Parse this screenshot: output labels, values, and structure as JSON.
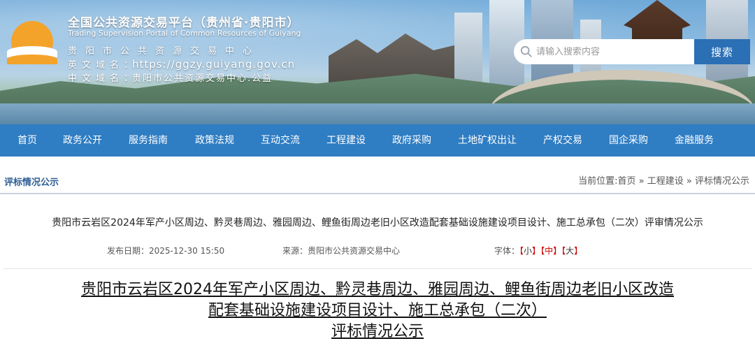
{
  "header": {
    "title": "全国公共资源交易平台（贵州省·贵阳市）",
    "title_en": "Trading Supervision Portal of Common Resources of Guiyang",
    "center_name": "贵阳市公共资源交易中心",
    "en_domain_label": "英文域名：",
    "en_domain_value": "https://ggzy.guiyang.gov.cn",
    "cn_domain_label": "中文域名：",
    "cn_domain_value": "贵阳市公共资源交易中心.公益",
    "brand_color": "#2f7dc3",
    "logo_color": "#f4a32a"
  },
  "search": {
    "placeholder": "请输入搜索内容",
    "button_label": "搜索",
    "icon": "search-icon"
  },
  "nav": {
    "items": [
      "首页",
      "政务公开",
      "服务指南",
      "政策法规",
      "互动交流",
      "工程建设",
      "政府采购",
      "土地矿权出让",
      "产权交易",
      "国企采购",
      "金融服务"
    ]
  },
  "breadcrumb": {
    "section_title": "评标情况公示",
    "path_label": "当前位置:",
    "path": [
      "首页",
      "工程建设",
      "评标情况公示"
    ],
    "separator": " » "
  },
  "article": {
    "title": "贵阳市云岩区2024年军产小区周边、黔灵巷周边、雅园周边、鲤鱼街周边老旧小区改造配套基础设施建设项目设计、施工总承包（二次）评审情况公示",
    "date_label": "发布日期：",
    "date_value": "2025-12-30 15:50",
    "source_label": "来源：",
    "source_value": "贵阳市公共资源交易中心",
    "font_label": "字体：",
    "font_small": "小",
    "font_medium": "中",
    "font_large": "大",
    "heading_lines": [
      "贵阳市云岩区2024年军产小区周边、黔灵巷周边、雅园周边、鲤鱼街周边老旧小区改造",
      "配套基础设施建设项目设计、施工总承包（二次）",
      "评标情况公示"
    ]
  }
}
